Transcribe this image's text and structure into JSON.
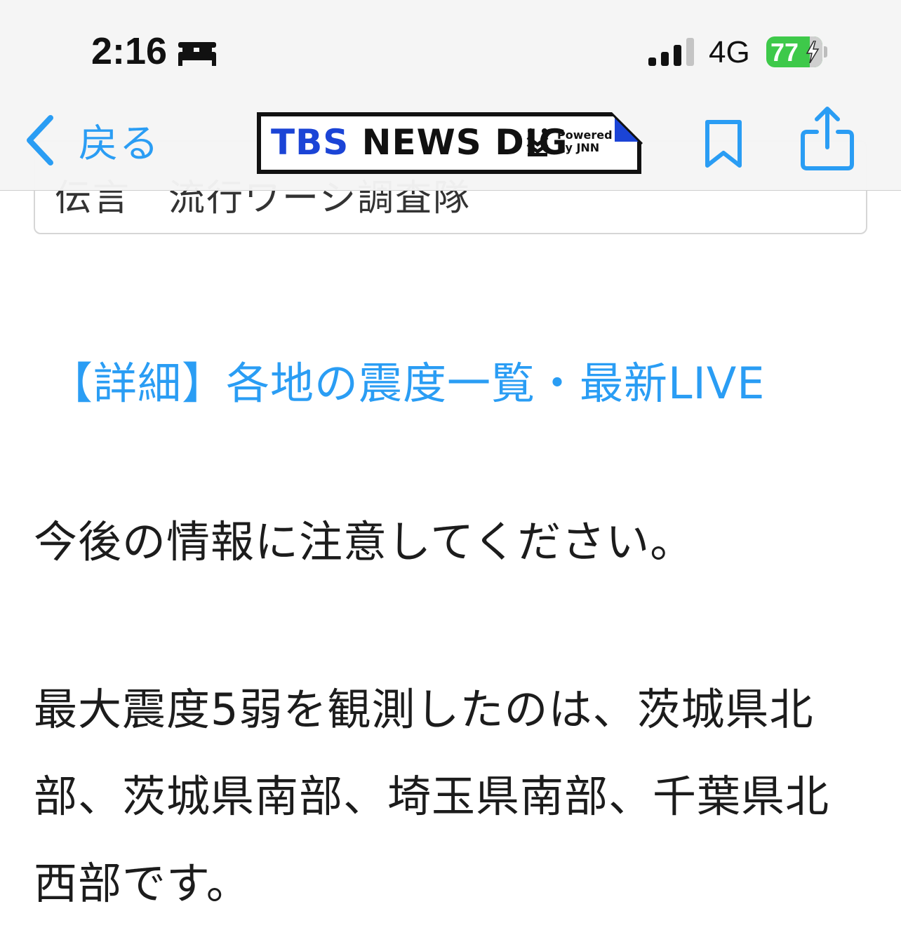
{
  "status_bar": {
    "time": "2:16",
    "network": "4G",
    "battery_percent": "77"
  },
  "nav": {
    "back_label": "戻る",
    "logo": {
      "brand_a": "TBS",
      "brand_b": " NEWS DIG",
      "powered_line1": "Powered",
      "powered_line2": "by JNN"
    }
  },
  "article": {
    "cut_box_text": "伝言　流行ワーシ調査隊",
    "link_text": "【詳細】各地の震度一覧・最新LIVE",
    "paragraph1": "今後の情報に注意してください。",
    "paragraph2_lines": [
      "最大震度5弱を観測したのは、茨城県北",
      "部、茨城県南部、埼玉県南部、千葉県北",
      "西部です。"
    ]
  },
  "colors": {
    "link": "#2a9df4",
    "ios_blue": "#2a9df4",
    "battery_green": "#3ec94a",
    "tbs_blue": "#1b44d6"
  }
}
